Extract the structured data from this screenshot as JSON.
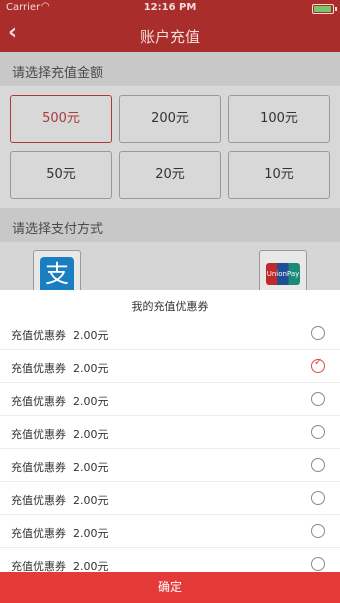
{
  "status_bar": {
    "carrier": "Carrier",
    "time": "12:16 PM"
  },
  "nav": {
    "title": "账户充值",
    "back_icon": "chevron-left-icon"
  },
  "amount_section": {
    "header": "请选择充值金额",
    "options": [
      "500元",
      "200元",
      "100元",
      "50元",
      "20元",
      "10元"
    ],
    "selected": "500元"
  },
  "payment_section": {
    "header": "请选择支付方式",
    "methods": [
      {
        "icon": "alipay-icon",
        "glyph": "支"
      },
      {
        "icon": "unionpay-icon",
        "glyph": "UnionPay 银联"
      }
    ]
  },
  "coupon_sheet": {
    "title": "我的充值优惠券",
    "coupons": [
      {
        "name": "充值优惠券",
        "amount": "2.00元",
        "checked": false
      },
      {
        "name": "充值优惠券",
        "amount": "2.00元",
        "checked": true
      },
      {
        "name": "充值优惠券",
        "amount": "2.00元",
        "checked": false
      },
      {
        "name": "充值优惠券",
        "amount": "2.00元",
        "checked": false
      },
      {
        "name": "充值优惠券",
        "amount": "2.00元",
        "checked": false
      },
      {
        "name": "充值优惠券",
        "amount": "2.00元",
        "checked": false
      },
      {
        "name": "充值优惠券",
        "amount": "2.00元",
        "checked": false
      },
      {
        "name": "充值优惠券",
        "amount": "2.00元",
        "checked": false
      }
    ],
    "confirm_label": "确定"
  },
  "colors": {
    "nav": "#a92d2b",
    "accent": "#e43b39",
    "selected_border": "#a93c3a"
  }
}
